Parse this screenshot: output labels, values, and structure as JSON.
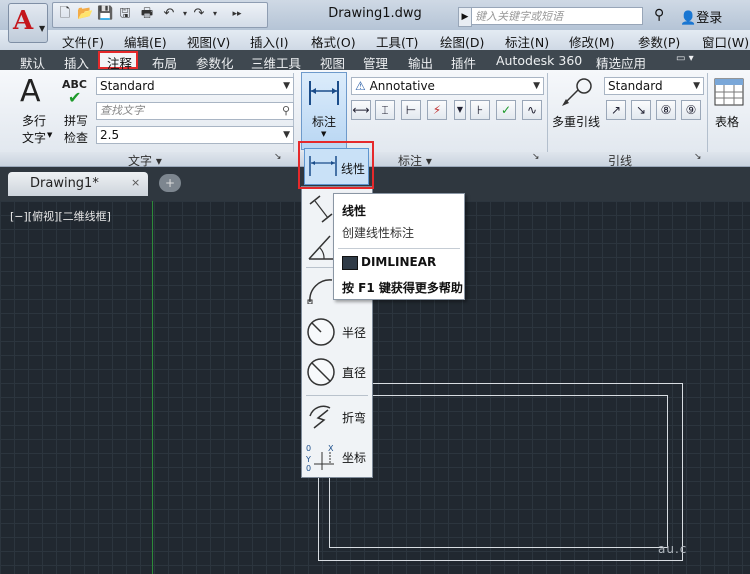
{
  "title_bar": {
    "app_letter": "A",
    "document_title": "Drawing1.dwg",
    "search_placeholder": "键入关键字或短语",
    "login_label": "登录"
  },
  "menu_bar": {
    "items": [
      "文件(F)",
      "编辑(E)",
      "视图(V)",
      "插入(I)",
      "格式(O)",
      "工具(T)",
      "绘图(D)",
      "标注(N)",
      "修改(M)",
      "参数(P)",
      "窗口(W)"
    ]
  },
  "ribbon_tabs": {
    "items": [
      "默认",
      "插入",
      "注释",
      "布局",
      "参数化",
      "三维工具",
      "视图",
      "管理",
      "输出",
      "插件",
      "Autodesk 360",
      "精选应用"
    ],
    "active": "注释"
  },
  "ribbon": {
    "text_panel": {
      "title": "文字",
      "mtext_label_1": "多行",
      "mtext_label_2": "文字",
      "spell_label_1": "拼写",
      "spell_label_2": "检查",
      "abc": "ABC",
      "text_style": "Standard",
      "find_placeholder": "查找文字",
      "text_height": "2.5"
    },
    "dim_panel": {
      "title": "标注",
      "big_button_label": "标注",
      "dim_style": "Annotative"
    },
    "leader_panel": {
      "title": "引线",
      "mleader_label": "多重引线",
      "mleader_style": "Standard"
    },
    "table_panel": {
      "table_label": "表格"
    }
  },
  "doc_tabs": {
    "active_tab": "Drawing1*",
    "close_glyph": "×"
  },
  "canvas": {
    "view_label": "[−][俯视][二维线框]",
    "watermark": "au.c"
  },
  "dim_dropdown": {
    "items": [
      {
        "name": "linear",
        "label": "线性"
      },
      {
        "name": "aligned",
        "label": ""
      },
      {
        "name": "angular",
        "label": ""
      },
      {
        "name": "arc-length",
        "label": ""
      },
      {
        "name": "radius",
        "label": "半径"
      },
      {
        "name": "diameter",
        "label": "直径"
      },
      {
        "name": "jogged",
        "label": "折弯"
      },
      {
        "name": "ordinate",
        "label": "坐标"
      }
    ]
  },
  "tooltip": {
    "title": "线性",
    "description": "创建线性标注",
    "command": "DIMLINEAR",
    "help": "按 F1 键获得更多帮助"
  },
  "colors": {
    "highlight_red": "#e5292b",
    "canvas_bg": "#212830",
    "ribbon_bg": "#eef2f6"
  }
}
